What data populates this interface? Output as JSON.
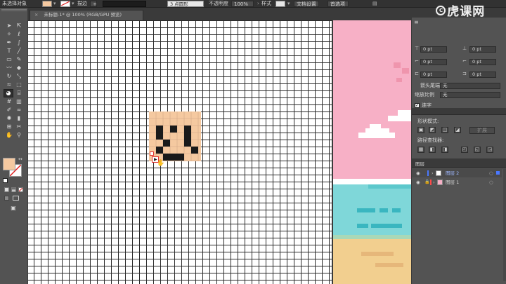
{
  "control_bar": {
    "selection_status": "未选择对象",
    "fill_color": "#f5c9a0",
    "stroke_label": "描边",
    "brush_label": "3 点圆形",
    "opacity_label": "不透明度",
    "opacity_value": "100%",
    "style_label": "样式",
    "doc_setup_button": "文档设置",
    "preferences_button": "首选项"
  },
  "brand": {
    "logo_text": "虎课网"
  },
  "document_tab": {
    "close": "×",
    "title": "未标题-1* @ 100% (RGB/GPU 预览)"
  },
  "stroke_panel": {
    "value_1": "0 pt",
    "value_2": "0 pt",
    "value_3": "0 pt",
    "value_4": "0 pt",
    "value_5": "0 pt",
    "value_6": "0 pt",
    "arrowhead_label": "箭头尾端",
    "arrowhead_value": "无",
    "scale_label": "缩放比例",
    "scale_value": "无",
    "hyphen_checkbox_label": "连字"
  },
  "pathfinder_panel": {
    "shape_modes_label": "形状模式:",
    "expand_button": "扩展",
    "pathfinders_label": "路径查找器:"
  },
  "layers_panel": {
    "title": "图层",
    "layers": [
      {
        "name": "图层 2",
        "color": "#4a78ff",
        "selected": true
      },
      {
        "name": "图层 1",
        "color": "#ff4a4a",
        "selected": false
      }
    ]
  },
  "colors": {
    "canvas_bg": "#ffffff",
    "pixel_skin": "#f5c9a0",
    "pixel_dark": "#1a1a1a",
    "ui_dark": "#323232",
    "ui_panel": "#535353",
    "sky_pink": "#f7b0c6",
    "sea_cyan": "#7fd7d9",
    "sea_dark": "#3ab6c0",
    "sand": "#f2cf8f"
  }
}
